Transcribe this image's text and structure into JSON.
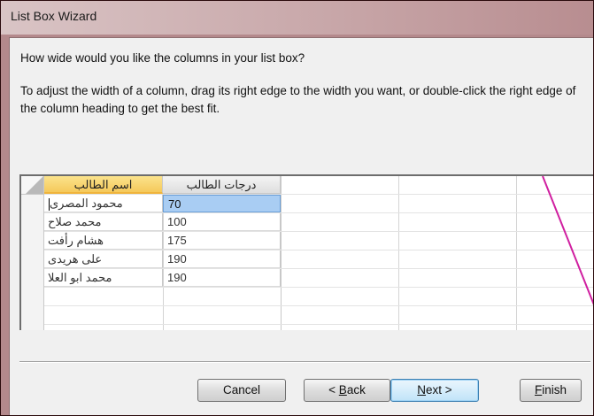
{
  "window": {
    "title": "List Box Wizard"
  },
  "question": "How wide would you like the columns in your list box?",
  "instructions": "To adjust the width of a column, drag its right edge to the width you want, or double-click the right edge of the column heading to get the best fit.",
  "grid": {
    "columns": [
      "اسم الطالب",
      "درجات الطالب"
    ],
    "rows": [
      {
        "name": "محمود المصرى",
        "grade": "70"
      },
      {
        "name": "محمد صلاح",
        "grade": "100"
      },
      {
        "name": "هشام رأفت",
        "grade": "175"
      },
      {
        "name": "على هريدى",
        "grade": "190"
      },
      {
        "name": "محمد ابو العلا",
        "grade": "190"
      }
    ],
    "selected_row": 0
  },
  "buttons": {
    "cancel": "Cancel",
    "back_accel": "B",
    "back_rest": "ack",
    "back_prefix": "< ",
    "next_accel": "N",
    "next_rest": "ext >",
    "finish_accel": "F",
    "finish_rest": "inish"
  },
  "colors": {
    "header_active": "#f5c95b",
    "selection": "#a9cdf3",
    "annotation_line": "#d01fa0"
  }
}
